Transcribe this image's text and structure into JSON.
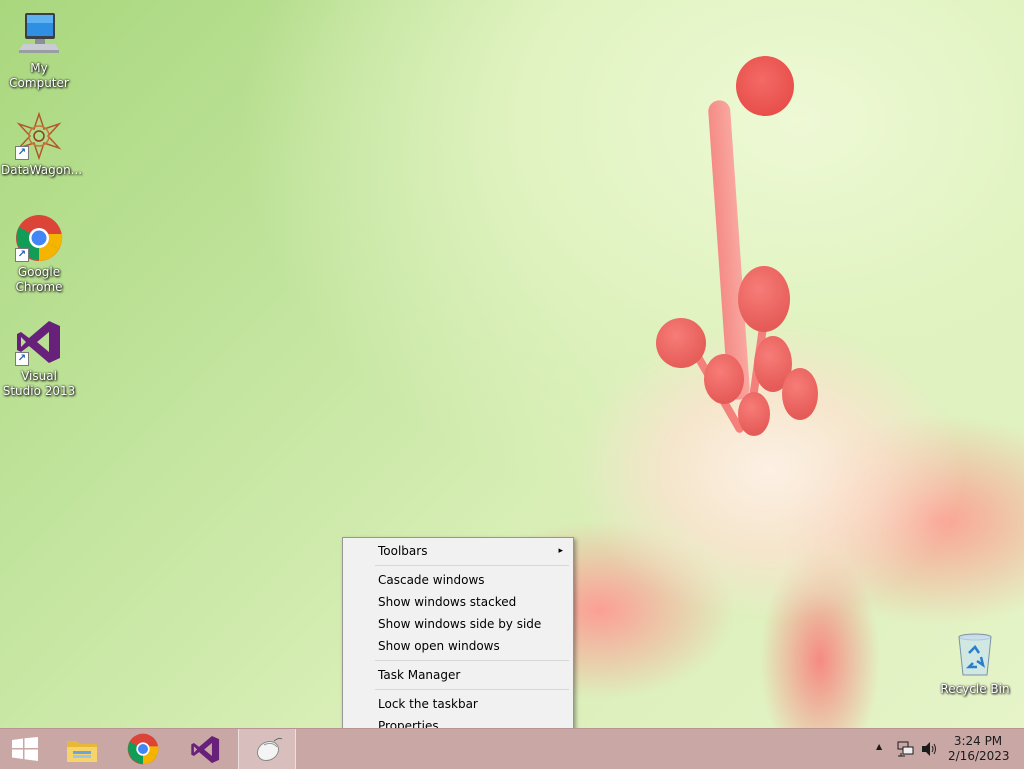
{
  "desktop": {
    "icons": [
      {
        "label": "My Computer",
        "icon": "computer-icon"
      },
      {
        "label": "DataWagon...",
        "icon": "datawagon-icon"
      },
      {
        "label": "Google Chrome",
        "icon": "chrome-icon"
      },
      {
        "label": "Visual Studio 2013",
        "icon": "visual-studio-icon"
      },
      {
        "label": "Recycle Bin",
        "icon": "recycle-bin-icon"
      }
    ]
  },
  "context_menu": {
    "items": [
      {
        "label": "Toolbars",
        "has_submenu": true
      },
      {
        "label": "Cascade windows"
      },
      {
        "label": "Show windows stacked"
      },
      {
        "label": "Show windows side by side"
      },
      {
        "label": "Show open windows"
      },
      {
        "label": "Task Manager"
      },
      {
        "label": "Lock the taskbar"
      },
      {
        "label": "Properties"
      }
    ],
    "submenu_arrow": "▸"
  },
  "taskbar": {
    "buttons": [
      "start-icon",
      "file-explorer-icon",
      "chrome-icon",
      "visual-studio-icon",
      "mouse-app-icon"
    ],
    "tray": {
      "time": "3:24 PM",
      "date": "2/16/2023",
      "overflow_arrow": "▲"
    }
  },
  "colors": {
    "taskbar": "#c9a7a5",
    "menu_bg": "#f1f1f1",
    "vs_purple": "#68217a"
  }
}
